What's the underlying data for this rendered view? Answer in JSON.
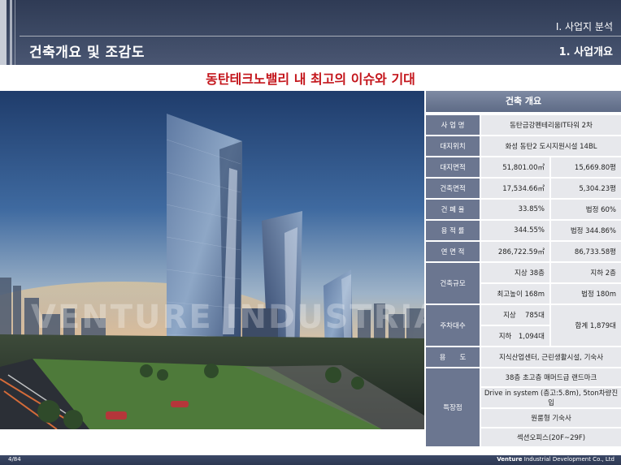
{
  "header": {
    "section": "I. 사업지 분석",
    "sub_section": "1. 사업개요",
    "page_title": "건축개요 및 조감도"
  },
  "headline": "동탄테크노밸리 내 최고의 이슈와 기대",
  "image": {
    "watermark": "VENTURE INDUSTRIAL DEVELOPMENT"
  },
  "spec_table": {
    "title": "건축 개요",
    "rows": {
      "project_name": {
        "label": "사 업 명",
        "value": "동탄금강펜테리움IT타워 2차"
      },
      "site_location": {
        "label": "대지위치",
        "value": "화성 동탄2 도시지원시설 14BL"
      },
      "site_area": {
        "label": "대지면적",
        "m2": "51,801.00㎡",
        "pyeong": "15,669.80평"
      },
      "building_area": {
        "label": "건축면적",
        "m2": "17,534.66㎡",
        "pyeong": "5,304.23평"
      },
      "coverage_ratio": {
        "label": "건 폐 율",
        "value": "33.85%",
        "legal": "법정 60%"
      },
      "floor_area_ratio": {
        "label": "용 적 률",
        "value": "344.55%",
        "legal": "법정 344.86%"
      },
      "gross_floor_area": {
        "label": "연 면 적",
        "m2": "286,722.59㎡",
        "pyeong": "86,733.58평"
      },
      "scale": {
        "label": "건축규모",
        "above": "지상 38층",
        "below": "지하 2층",
        "height": "최고높이 168m",
        "legal_height": "법정 180m"
      },
      "parking": {
        "label": "주차대수",
        "above": "지상　 785대",
        "below": "지하　1,094대",
        "total": "합계 1,879대"
      },
      "use": {
        "label": "용　　도",
        "value": "지식산업센터, 근린생활시설, 기숙사"
      },
      "features": {
        "label": "특장점",
        "items": [
          "38층 초고층 매머드급 랜드마크",
          "Drive in system (층고:5.8m), 5ton차량진입",
          "원룸형 기숙사",
          "섹션오피스(20F~29F)"
        ]
      }
    }
  },
  "footer": {
    "page": "4/84",
    "company_bold": "Venture",
    "company_rest": " Industrial Development Co., Ltd"
  }
}
